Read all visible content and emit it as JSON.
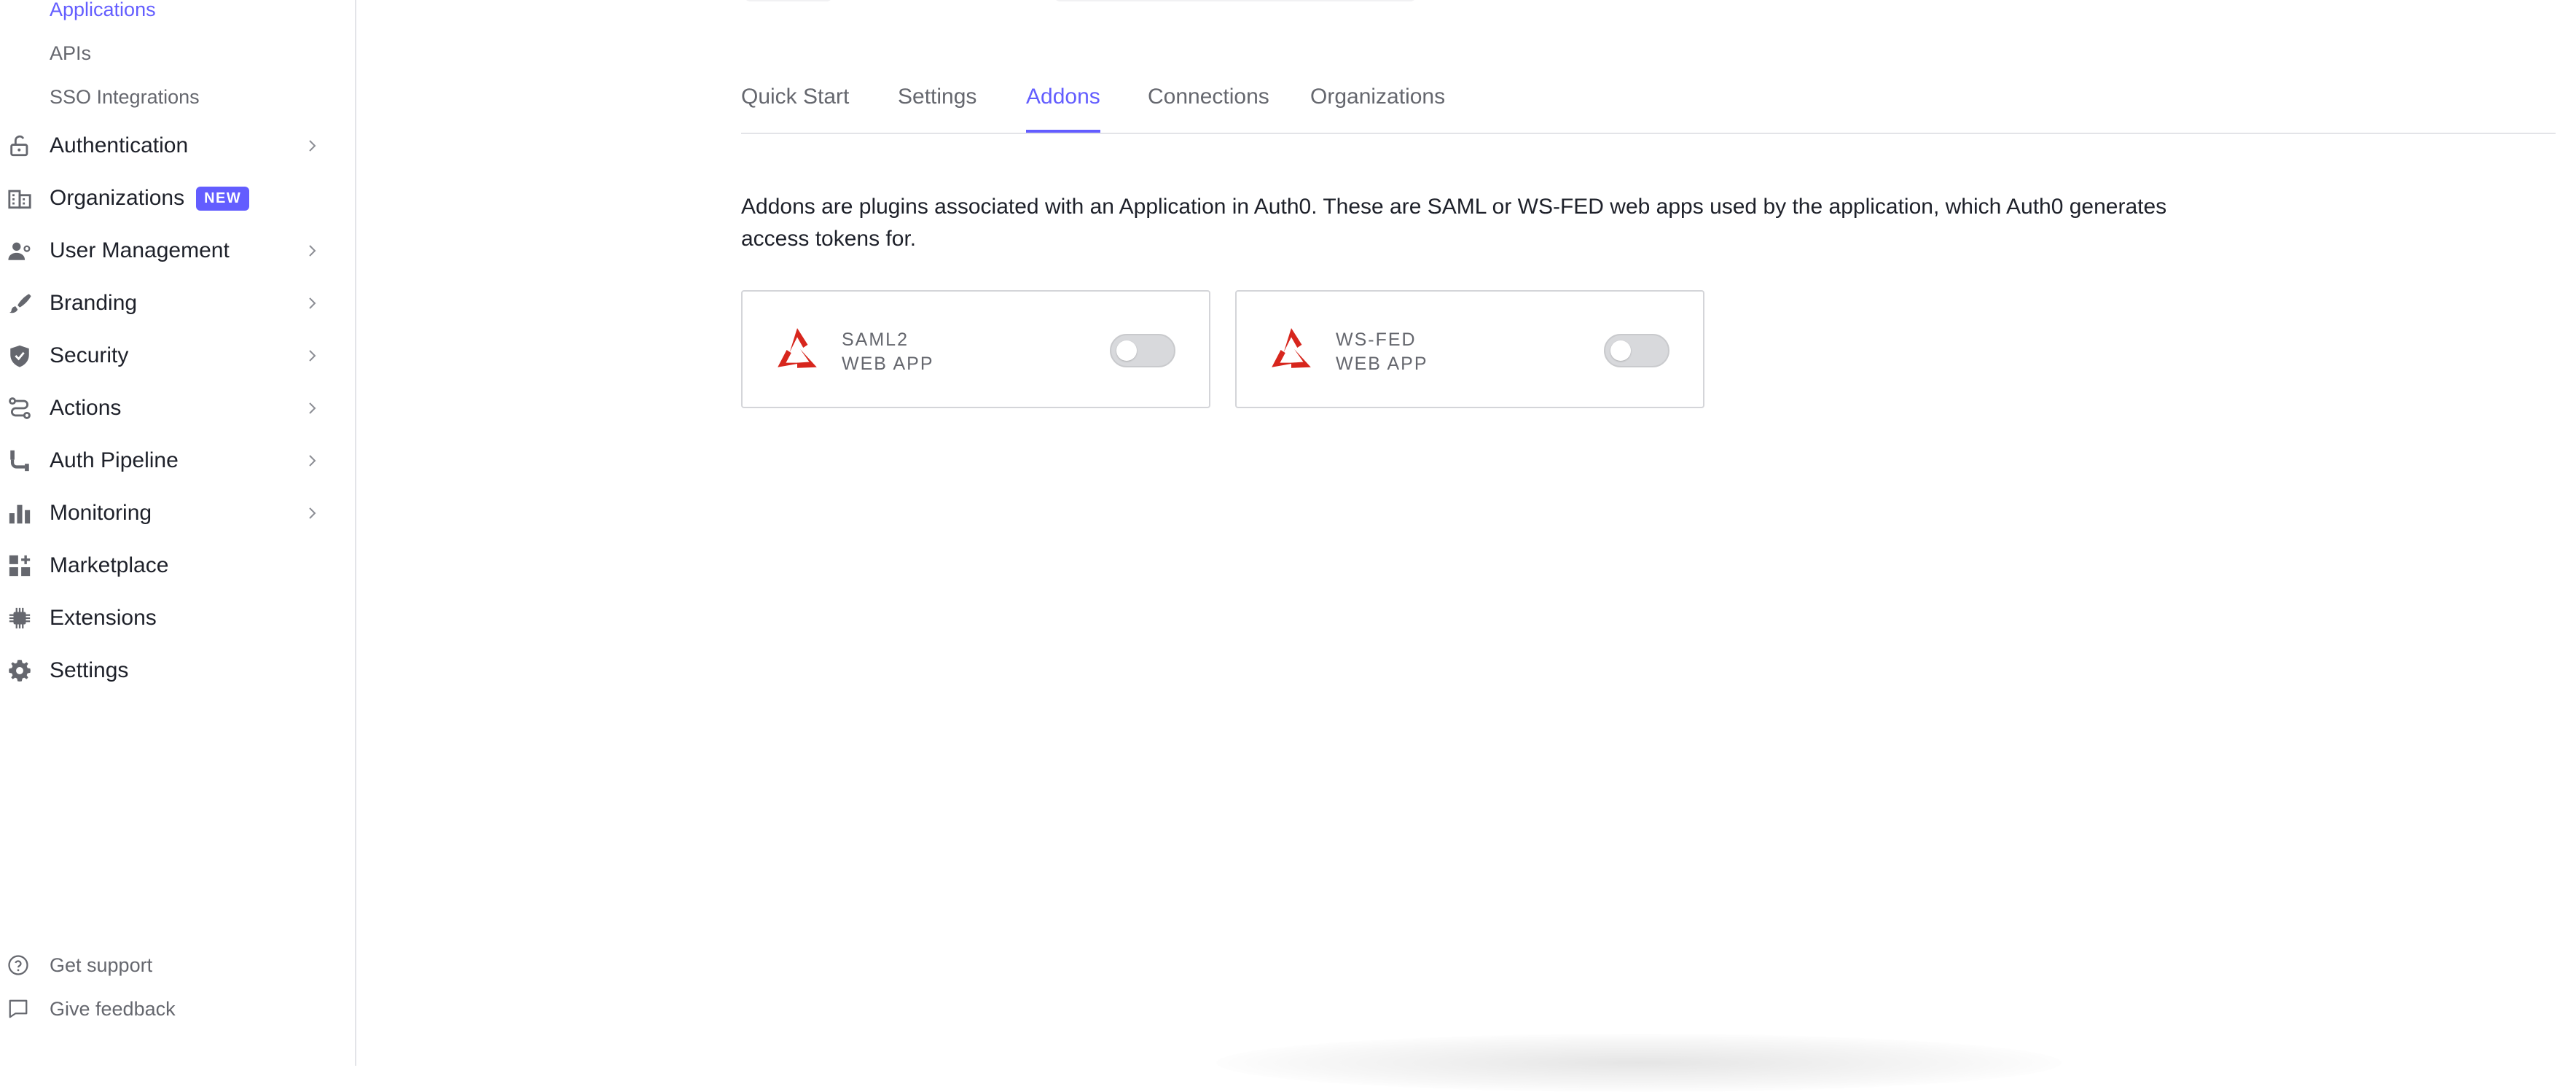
{
  "sidebar": {
    "sub_items": [
      {
        "label": "Applications",
        "active": true
      },
      {
        "label": "APIs",
        "active": false
      },
      {
        "label": "SSO Integrations",
        "active": false
      }
    ],
    "items": [
      {
        "label": "Authentication",
        "icon": "lock-icon",
        "chevron": true
      },
      {
        "label": "Organizations",
        "icon": "building-icon",
        "badge": "NEW",
        "chevron": false
      },
      {
        "label": "User Management",
        "icon": "user-icon",
        "chevron": true
      },
      {
        "label": "Branding",
        "icon": "brush-icon",
        "chevron": true
      },
      {
        "label": "Security",
        "icon": "shield-icon",
        "chevron": true
      },
      {
        "label": "Actions",
        "icon": "actions-flow-icon",
        "chevron": true
      },
      {
        "label": "Auth Pipeline",
        "icon": "pipeline-icon",
        "chevron": true
      },
      {
        "label": "Monitoring",
        "icon": "bar-chart-icon",
        "chevron": true
      },
      {
        "label": "Marketplace",
        "icon": "grid-plus-icon",
        "chevron": false
      },
      {
        "label": "Extensions",
        "icon": "chip-icon",
        "chevron": false
      },
      {
        "label": "Settings",
        "icon": "gear-icon",
        "chevron": false
      }
    ],
    "footer": [
      {
        "label": "Get support",
        "icon": "help-circle-icon"
      },
      {
        "label": "Give feedback",
        "icon": "chat-bubble-icon"
      }
    ]
  },
  "tabs": [
    {
      "label": "Quick Start",
      "active": false
    },
    {
      "label": "Settings",
      "active": false
    },
    {
      "label": "Addons",
      "active": true
    },
    {
      "label": "Connections",
      "active": false
    },
    {
      "label": "Organizations",
      "active": false
    }
  ],
  "description": "Addons are plugins associated with an Application in Auth0. These are SAML or WS-FED web apps used by the application, which Auth0 generates access tokens for.",
  "addons": [
    {
      "line1": "SAML2",
      "line2": "WEB APP",
      "enabled": false
    },
    {
      "line1": "WS-FED",
      "line2": "WEB APP",
      "enabled": false
    }
  ],
  "colors": {
    "accent": "#635dff",
    "text": "#1e212a",
    "muted": "#65676e",
    "logo_red": "#d7261d"
  }
}
